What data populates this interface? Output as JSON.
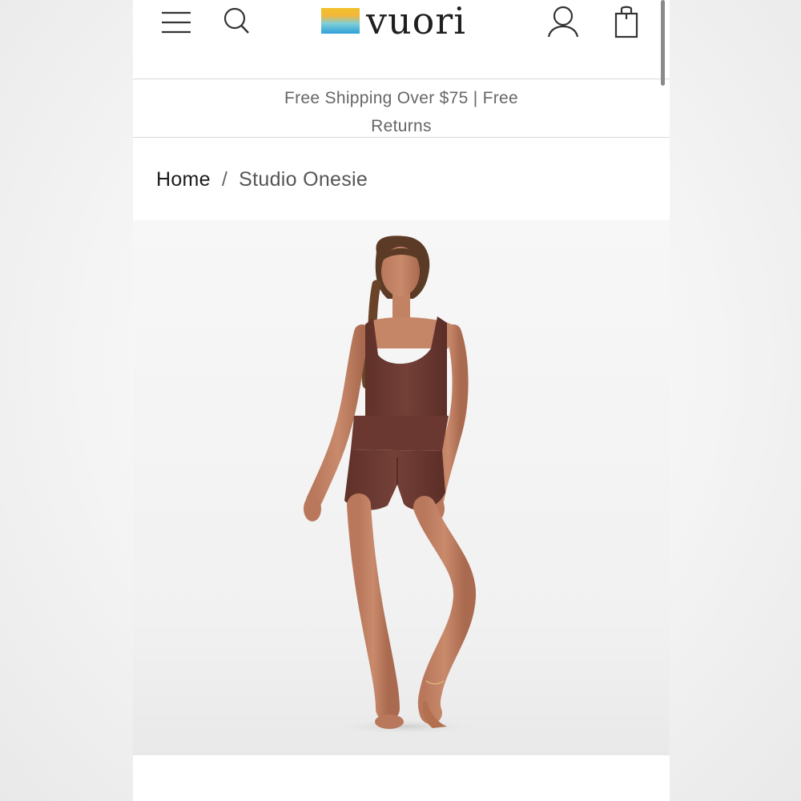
{
  "header": {
    "menu_icon": "hamburger-menu-icon",
    "search_icon": "search-icon",
    "logo_text": "vuori",
    "account_icon": "account-icon",
    "bag_icon": "shopping-bag-icon"
  },
  "promo": {
    "text": "Free Shipping Over $75 | Free Returns"
  },
  "breadcrumb": {
    "home": "Home",
    "separator": "/",
    "current": "Studio Onesie"
  },
  "product": {
    "image_subject": "model wearing brown studio onesie",
    "garment_color": "#6e3a32"
  },
  "colors": {
    "logo_gradient_top": "#f2c12b",
    "logo_gradient_bottom": "#2e9fd9",
    "text_primary": "#1a1a1a",
    "text_muted": "#666666"
  }
}
